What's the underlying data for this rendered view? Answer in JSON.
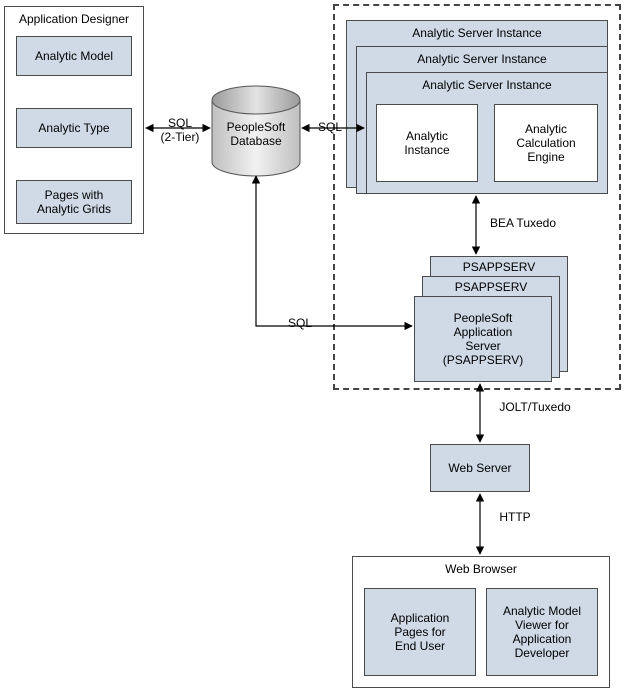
{
  "app_designer": {
    "title": "Application Designer",
    "items": [
      "Analytic Model",
      "Analytic Type",
      "Pages with\nAnalytic Grids"
    ]
  },
  "database": {
    "label": "PeopleSoft\nDatabase"
  },
  "sql_2tier": "SQL\n(2-Tier)",
  "sql_a": "SQL",
  "sql_b": "SQL",
  "server_group": {
    "asi_title": "Analytic Server Instance",
    "asi_inner": [
      "Analytic\nInstance",
      "Analytic\nCalculation\nEngine"
    ],
    "bea": "BEA Tuxedo",
    "psapp_title": "PSAPPSERV",
    "psapp_main": "PeopleSoft\nApplication\nServer\n(PSAPPSERV)"
  },
  "jolt": "JOLT/Tuxedo",
  "web_server": "Web Server",
  "http": "HTTP",
  "browser": {
    "title": "Web Browser",
    "left": "Application\nPages for\nEnd User",
    "right": "Analytic Model\nViewer for\nApplication\nDeveloper"
  }
}
